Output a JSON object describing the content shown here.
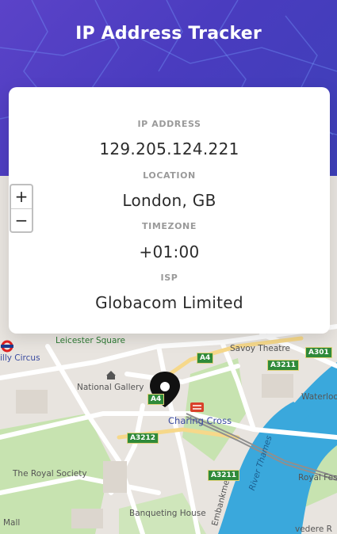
{
  "header": {
    "title": "IP Address Tracker"
  },
  "result": {
    "ip_label": "IP ADDRESS",
    "ip_value": "129.205.124.221",
    "location_label": "LOCATION",
    "location_value": "London, GB",
    "timezone_label": "TIMEZONE",
    "timezone_value": "+01:00",
    "isp_label": "ISP",
    "isp_value": "Globacom Limited"
  },
  "map": {
    "zoom_in": "+",
    "zoom_out": "−",
    "labels": {
      "leicester_square": "Leicester Square",
      "savoy_theatre": "Savoy Theatre",
      "piccadilly_circus": "illy Circus",
      "national_gallery": "National Gallery",
      "charing_cross": "Charing Cross",
      "waterloo": "Waterloo",
      "royal_society": "The Royal Society",
      "banqueting_house": "Banqueting House",
      "river_thames": "River Thames",
      "royal_festival": "Royal Fes",
      "mall": "Mall",
      "embankment": "Embankment",
      "belvedere": "vedere R"
    },
    "roads": {
      "a4": "A4",
      "a301": "A301",
      "a3211_top": "A3211",
      "a3212": "A3212",
      "a3211_bottom": "A3211",
      "a4_small": "A4"
    }
  },
  "colors": {
    "header_gradient_start": "#5b43c8",
    "header_gradient_end": "#3d3fb8",
    "water": "#3aa8dc",
    "park": "#c7e3b0",
    "road_badge": "#2f8a3a"
  }
}
